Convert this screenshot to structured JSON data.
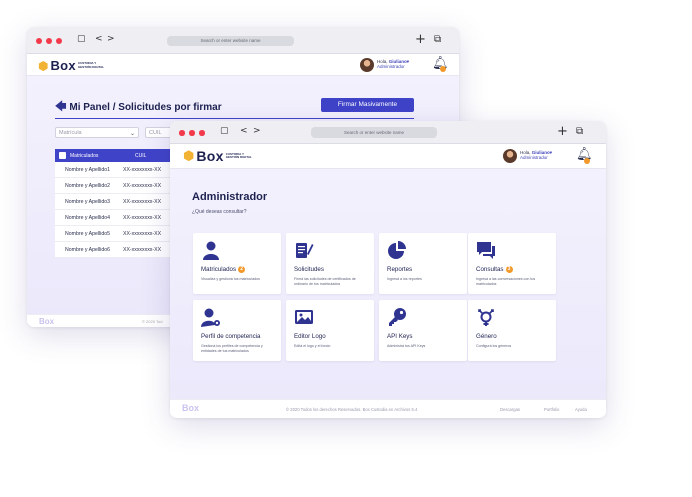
{
  "browser": {
    "url_placeholder": "Search or enter website name",
    "nav_back": "<",
    "nav_forward": ">",
    "new_tab": "+",
    "tabs_icon": "⧉",
    "sidebar_icon": "▢",
    "traffic_light_color": "#f23a4a"
  },
  "brand": {
    "name": "Box",
    "tagline_1": "CUSTODIA Y",
    "tagline_2": "GESTIÓN DIGITAL",
    "mark_icon": "cube-logo-icon",
    "accent": "#f2b233"
  },
  "user": {
    "greeting": "Hola,",
    "name": "Giuliano",
    "caret": "▾",
    "role": "Administrador"
  },
  "back_page": {
    "title": "Mi Panel / Solicitudes por firmar",
    "back_arrow": "🡄",
    "action_button": "Firmar Masivamente",
    "filter_select": "Matrícula",
    "filter_select_2": "CUIL",
    "table": {
      "columns": [
        "Matriculados",
        "CUIL"
      ],
      "rows": [
        {
          "name": "Nombre y Apellido1",
          "cuil": "XX-xxxxxxxx-XX"
        },
        {
          "name": "Nombre y Apellido2",
          "cuil": "XX-xxxxxxxx-XX"
        },
        {
          "name": "Nombre y Apellido3",
          "cuil": "XX-xxxxxxxx-XX"
        },
        {
          "name": "Nombre y Apellido4",
          "cuil": "XX-xxxxxxxx-XX"
        },
        {
          "name": "Nombre y Apellido5",
          "cuil": "XX-xxxxxxxx-XX"
        },
        {
          "name": "Nombre y Apellido6",
          "cuil": "XX-xxxxxxxx-XX"
        }
      ]
    },
    "footer_copy": "© 2020 Tod"
  },
  "front_page": {
    "title": "Administrador",
    "subtitle": "¿Qué deseas consultar?",
    "cards": [
      {
        "title": "Matriculados",
        "badge": "2",
        "desc": "Visualizá y gestioná tus matriculados",
        "icon": "person-icon"
      },
      {
        "title": "Solicitudes",
        "badge": "",
        "desc": "Firmá las solicitudes de certificados de ordinario de tus matriculados",
        "icon": "document-sign-icon"
      },
      {
        "title": "Reportes",
        "badge": "",
        "desc": "Ingresá a los reportes",
        "icon": "pie-chart-icon"
      },
      {
        "title": "Consultas",
        "badge": "3",
        "desc": "Ingresá a las conversaciones con tus matriculados",
        "icon": "chat-icon"
      },
      {
        "title": "Perfil de competencia",
        "badge": "",
        "desc": "Gestioná los perfiles de competencia y entidades de tus matriculados",
        "icon": "person-settings-icon"
      },
      {
        "title": "Editor Logo",
        "badge": "",
        "desc": "Editá el logo y el fondo",
        "icon": "image-icon"
      },
      {
        "title": "API Keys",
        "badge": "",
        "desc": "Administrá tus API Keys",
        "icon": "key-icon"
      },
      {
        "title": "Género",
        "badge": "",
        "desc": "Configurá los géneros",
        "icon": "gender-icon"
      }
    ],
    "footer": {
      "copyright": "© 2020 Todos los derechos Reservados. Box Custodia en Archivos 5.4",
      "link_1": "Descargas",
      "link_2": "Portfolio",
      "link_3": "Ayuda"
    }
  },
  "colors": {
    "primary": "#3f43c8",
    "navy": "#1d2150",
    "badge": "#f2992b"
  }
}
